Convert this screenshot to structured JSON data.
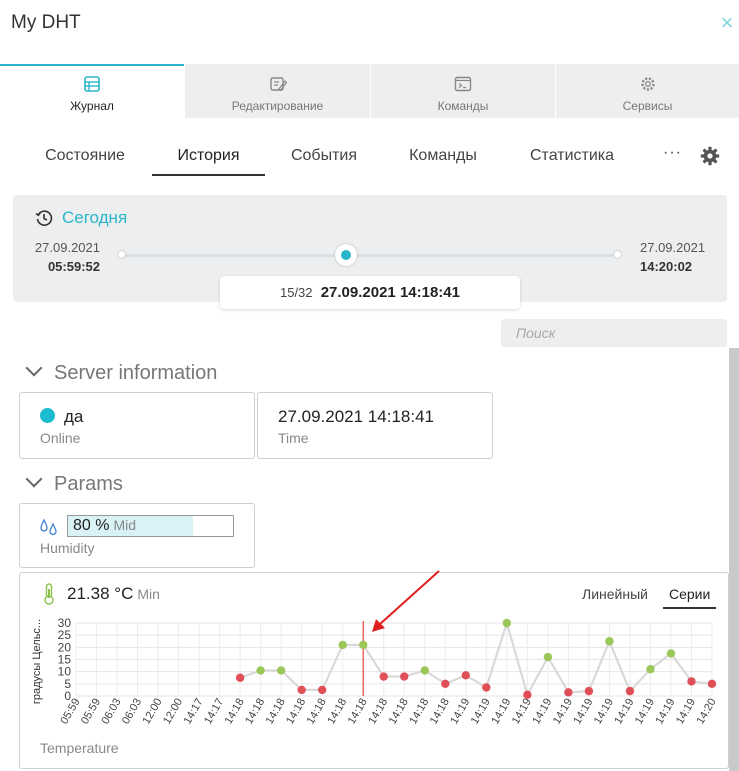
{
  "header": {
    "title": "My DHT",
    "close_label": "×"
  },
  "main_tabs": [
    {
      "label": "Журнал",
      "icon": "journal-icon",
      "active": true
    },
    {
      "label": "Редактирование",
      "icon": "edit-icon",
      "active": false
    },
    {
      "label": "Команды",
      "icon": "terminal-icon",
      "active": false
    },
    {
      "label": "Сервисы",
      "icon": "services-gear-icon",
      "active": false
    }
  ],
  "sub_tabs": [
    {
      "label": "Состояние",
      "active": false
    },
    {
      "label": "История",
      "active": true
    },
    {
      "label": "События",
      "active": false
    },
    {
      "label": "Команды",
      "active": false
    },
    {
      "label": "Статистика",
      "active": false
    }
  ],
  "more_label": "···",
  "history": {
    "period_label": "Сегодня",
    "start_date": "27.09.2021",
    "start_time": "05:59:52",
    "end_date": "27.09.2021",
    "end_time": "14:20:02",
    "position_fraction": 0.4516,
    "counter": "15/32",
    "current_value": "27.09.2021 14:18:41"
  },
  "search": {
    "placeholder": "Поиск"
  },
  "server_information": {
    "title": "Server information",
    "online": {
      "value": "да",
      "caption": "Online",
      "color": "#1cbcd0"
    },
    "time": {
      "value": "27.09.2021 14:18:41",
      "caption": "Time"
    }
  },
  "params": {
    "title": "Params",
    "humidity": {
      "value": "80 %",
      "level": "Mid",
      "percent": 80,
      "caption": "Humidity"
    },
    "temperature": {
      "value": "21.38 °C",
      "level": "Min",
      "caption": "Temperature"
    }
  },
  "chart_tabs": [
    {
      "label": "Линейный",
      "active": false
    },
    {
      "label": "Серии",
      "active": true
    }
  ],
  "colors": {
    "accent": "#29b6c8",
    "point_high": "#9bc758",
    "point_low": "#e04f57",
    "cursor": "#e8534b",
    "line": "#d9d9d9"
  },
  "chart_data": {
    "type": "line",
    "ylabel": "градусы Цельс...",
    "ylim": [
      0,
      30
    ],
    "yticks": [
      0,
      5,
      10,
      15,
      20,
      25,
      30
    ],
    "x": [
      "05:59",
      "05:59",
      "06:03",
      "06:03",
      "12:00",
      "12:00",
      "14:17",
      "14:17",
      "14:18",
      "14:18",
      "14:18",
      "14:18",
      "14:18",
      "14:18",
      "14:18",
      "14:18",
      "14:18",
      "14:18",
      "14:18",
      "14:19",
      "14:19",
      "14:19",
      "14:19",
      "14:19",
      "14:19",
      "14:19",
      "14:19",
      "14:19",
      "14:19",
      "14:19",
      "14:19",
      "14:20"
    ],
    "values": [
      null,
      null,
      null,
      null,
      null,
      null,
      null,
      null,
      7.5,
      10.5,
      10.5,
      2.5,
      2.5,
      21,
      21,
      8,
      8,
      10.5,
      5,
      8.5,
      3.5,
      30,
      0.5,
      16,
      1.5,
      2,
      22.5,
      2,
      11,
      17.5,
      6,
      5
    ],
    "current_index": 14
  }
}
